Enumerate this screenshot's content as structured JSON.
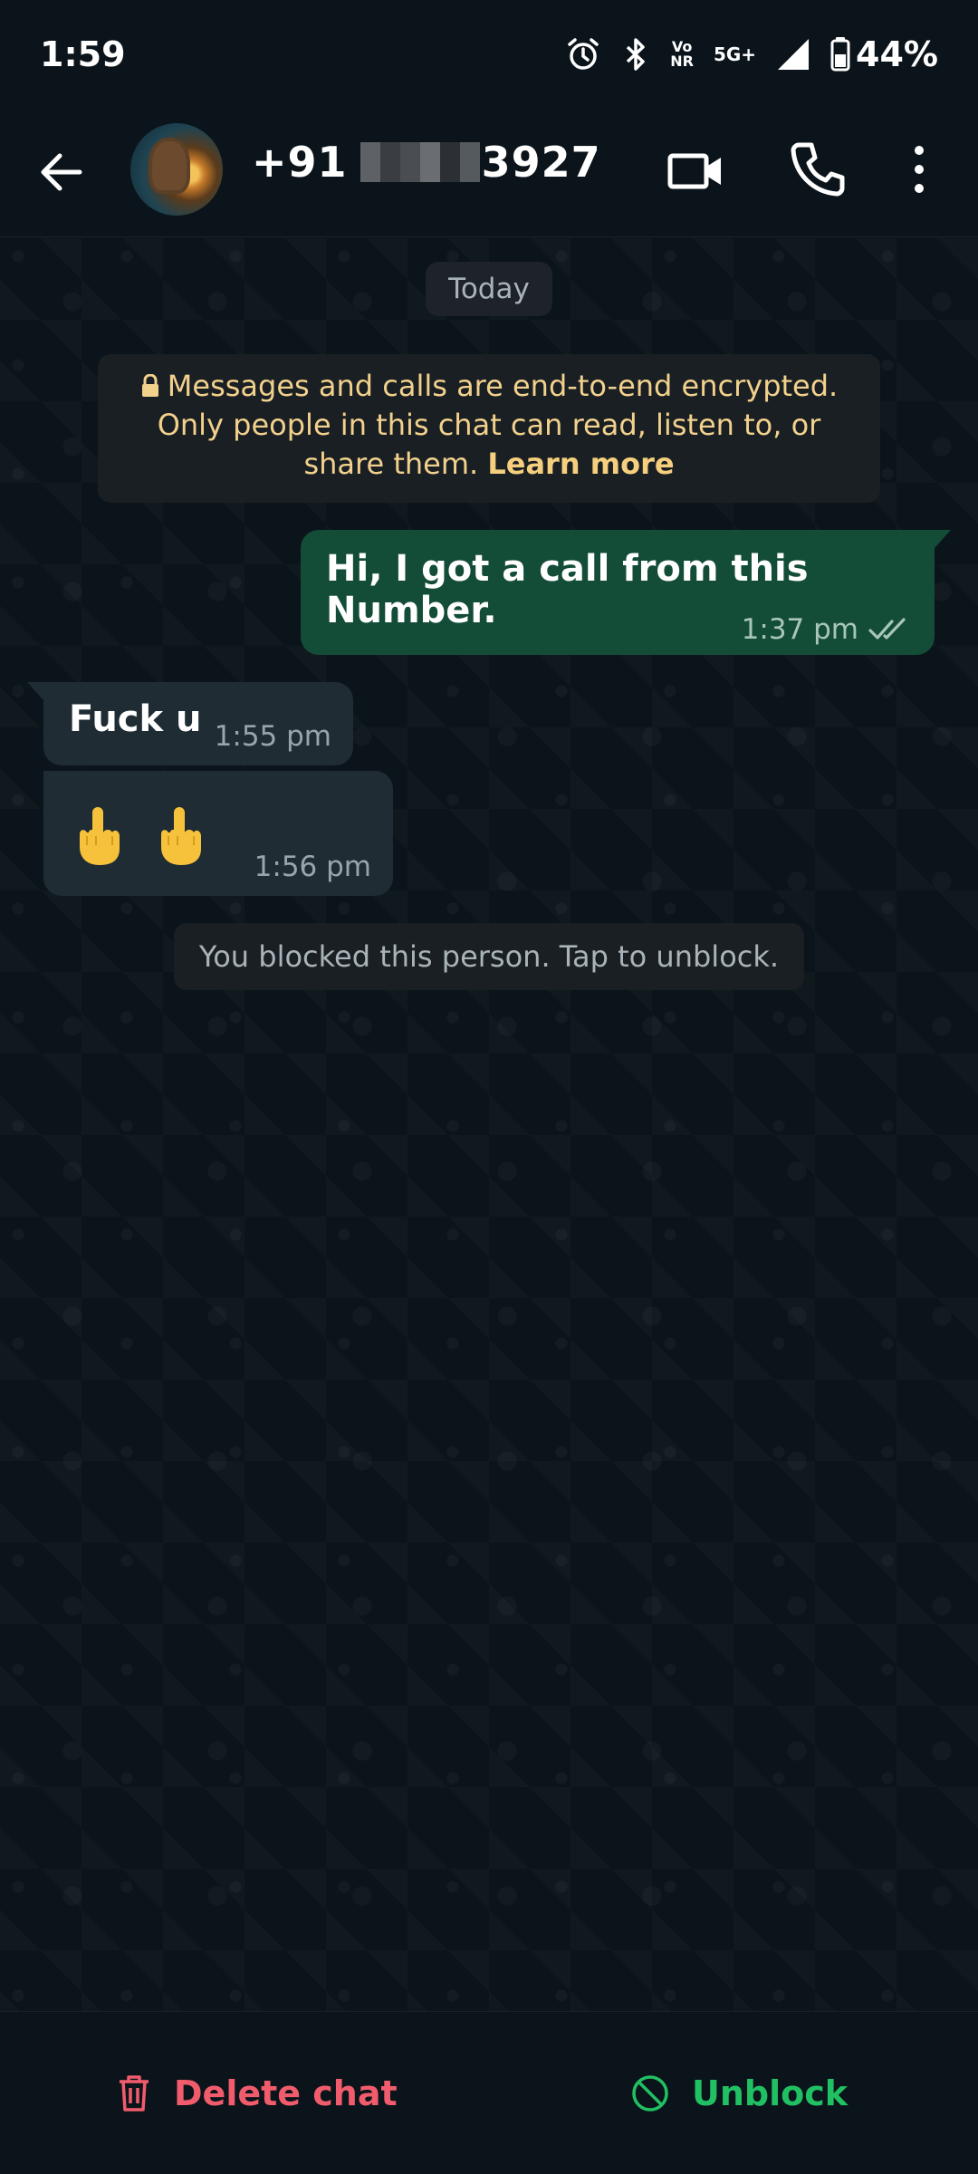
{
  "status_bar": {
    "time": "1:59",
    "volte_label": "Vo\nNR",
    "network_label": "5G+",
    "battery": "44%"
  },
  "header": {
    "contact_prefix": "+91",
    "contact_suffix": "3927",
    "icons": [
      "back-arrow-icon",
      "video-call-icon",
      "voice-call-icon",
      "more-options-icon"
    ]
  },
  "chat": {
    "date_chip": "Today",
    "encryption": {
      "text": "Messages and calls are end-to-end encrypted. Only people in this chat can read, listen to, or share them.",
      "link": "Learn more"
    },
    "messages": [
      {
        "direction": "outgoing",
        "text": "Hi, I got a call from this Number.",
        "time": "1:37 pm",
        "status": "read"
      },
      {
        "direction": "incoming",
        "text": "Fuck u",
        "time": "1:55 pm"
      },
      {
        "direction": "incoming",
        "text": "🖕 🖕",
        "time": "1:56 pm"
      }
    ],
    "blocked_notice": "You blocked this person. Tap to unblock."
  },
  "bottom_bar": {
    "delete_label": "Delete chat",
    "unblock_label": "Unblock"
  },
  "colors": {
    "background": "#0b141a",
    "outgoing_bubble": "#134d37",
    "incoming_bubble": "#1f2c34",
    "danger": "#f15c6d",
    "success": "#21c063",
    "notice_text": "#f2d18d"
  }
}
